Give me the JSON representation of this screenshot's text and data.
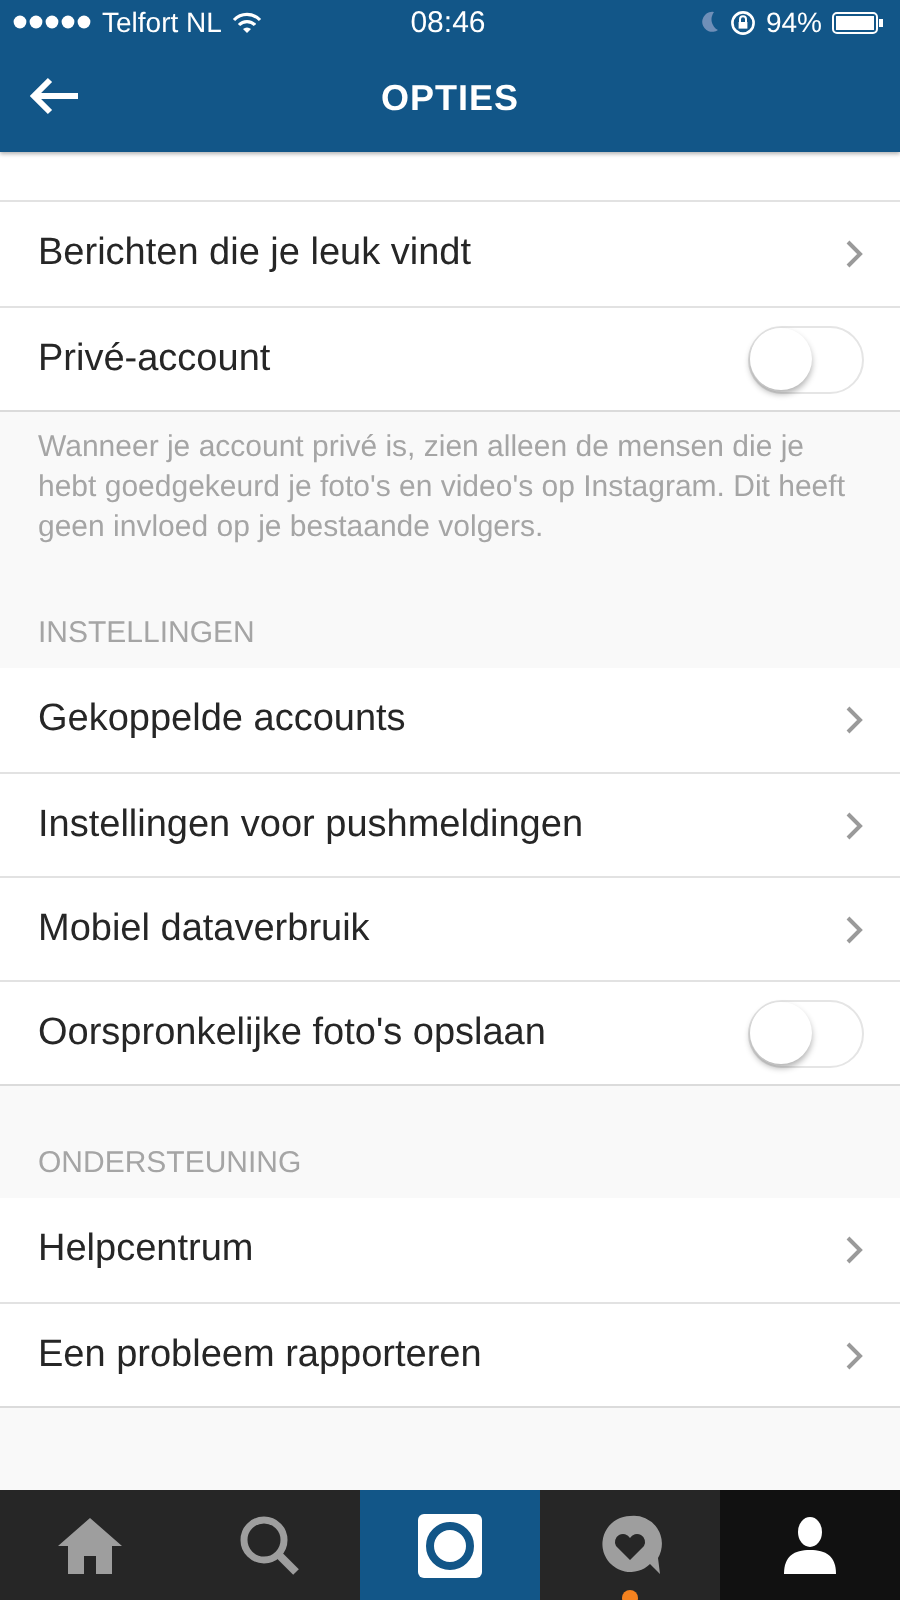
{
  "status_bar": {
    "carrier": "Telfort NL",
    "time": "08:46",
    "battery": "94%"
  },
  "header": {
    "title": "OPTIES"
  },
  "sections": [
    {
      "rows": [
        {
          "kind": "link",
          "label": "Berichten die je leuk vindt"
        },
        {
          "kind": "toggle",
          "label": "Privé-account",
          "on": false
        }
      ],
      "note": "Wanneer je account privé is, zien alleen de mensen die je hebt goedgekeurd je foto's en video's op Instagram. Dit heeft geen invloed op je bestaande volgers."
    },
    {
      "title": "INSTELLINGEN",
      "rows": [
        {
          "kind": "link",
          "label": "Gekoppelde accounts"
        },
        {
          "kind": "link",
          "label": "Instellingen voor pushmeldingen"
        },
        {
          "kind": "link",
          "label": "Mobiel dataverbruik"
        },
        {
          "kind": "toggle",
          "label": "Oorspronkelijke foto's opslaan",
          "on": false
        }
      ]
    },
    {
      "title": "ONDERSTEUNING",
      "rows": [
        {
          "kind": "link",
          "label": "Helpcentrum"
        },
        {
          "kind": "link",
          "label": "Een probleem rapporteren"
        }
      ]
    }
  ],
  "tab_bar": [
    {
      "kind": "home",
      "selected": false,
      "badge": false
    },
    {
      "kind": "search",
      "selected": false,
      "badge": false
    },
    {
      "kind": "camera",
      "selected": false,
      "badge": false
    },
    {
      "kind": "activity",
      "selected": false,
      "badge": true
    },
    {
      "kind": "profile",
      "selected": true,
      "badge": false
    }
  ]
}
